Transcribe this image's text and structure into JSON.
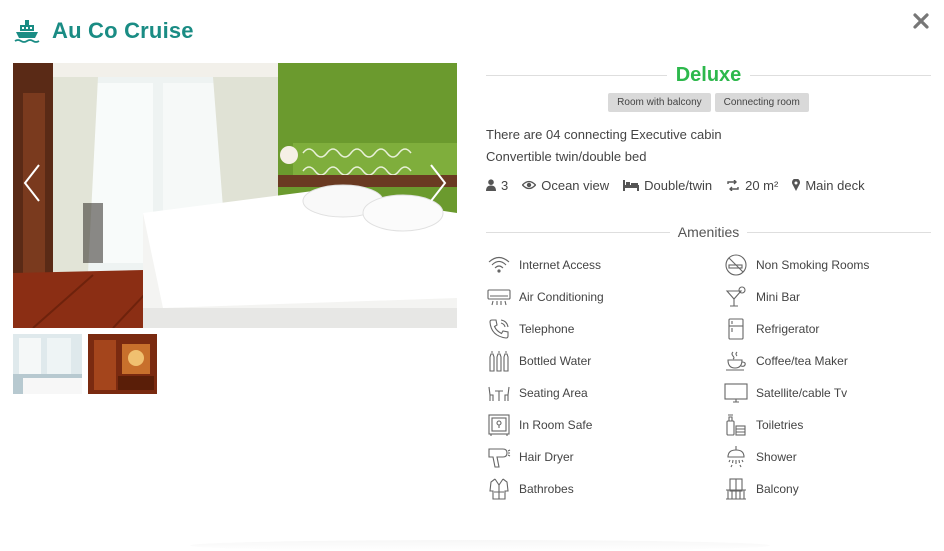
{
  "header": {
    "title": "Au Co Cruise",
    "logo_icon": "ship-icon",
    "brand_color": "#1a8c84"
  },
  "close_icon": "close-icon",
  "gallery": {
    "main_image": "cabin-bedroom-photo",
    "thumbnails": [
      "thumbnail-bedroom",
      "thumbnail-bathroom"
    ],
    "prev_icon": "chevron-left-icon",
    "next_icon": "chevron-right-icon"
  },
  "room": {
    "name": "Deluxe",
    "name_color": "#2db84c",
    "tags": [
      "Room with balcony",
      "Connecting room"
    ],
    "description": [
      "There are 04 connecting Executive cabin",
      "Convertible twin/double bed"
    ],
    "specs": {
      "guests": "3",
      "view": "Ocean view",
      "bed": "Double/twin",
      "size": "20 m²",
      "deck": "Main deck"
    }
  },
  "amenities": {
    "title": "Amenities",
    "items": [
      {
        "label": "Internet Access",
        "icon": "wifi-icon"
      },
      {
        "label": "Non Smoking Rooms",
        "icon": "no-smoking-icon"
      },
      {
        "label": "Air Conditioning",
        "icon": "air-conditioner-icon"
      },
      {
        "label": "Mini Bar",
        "icon": "cocktail-icon"
      },
      {
        "label": "Telephone",
        "icon": "phone-icon"
      },
      {
        "label": "Refrigerator",
        "icon": "fridge-icon"
      },
      {
        "label": "Bottled Water",
        "icon": "bottles-icon"
      },
      {
        "label": "Coffee/tea Maker",
        "icon": "coffee-cup-icon"
      },
      {
        "label": "Seating Area",
        "icon": "seating-icon"
      },
      {
        "label": "Satellite/cable Tv",
        "icon": "tv-icon"
      },
      {
        "label": "In Room Safe",
        "icon": "safe-icon"
      },
      {
        "label": "Toiletries",
        "icon": "toiletries-icon"
      },
      {
        "label": "Hair Dryer",
        "icon": "hair-dryer-icon"
      },
      {
        "label": "Shower",
        "icon": "shower-icon"
      },
      {
        "label": "Bathrobes",
        "icon": "bathrobe-icon"
      },
      {
        "label": "Balcony",
        "icon": "balcony-icon"
      }
    ]
  }
}
